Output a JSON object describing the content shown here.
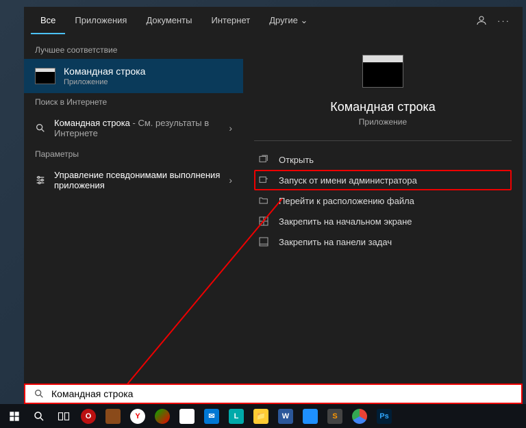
{
  "tabs": {
    "all": "Все",
    "apps": "Приложения",
    "docs": "Документы",
    "web": "Интернет",
    "more": "Другие"
  },
  "sections": {
    "best_match": "Лучшее соответствие",
    "web_search": "Поиск в Интернете",
    "settings": "Параметры"
  },
  "best_match": {
    "title": "Командная строка",
    "subtitle": "Приложение"
  },
  "web_result": {
    "prefix": "Командная строка",
    "suffix": " - См. результаты в Интернете"
  },
  "settings_result": {
    "title": "Управление псевдонимами выполнения приложения"
  },
  "preview": {
    "title": "Командная строка",
    "subtitle": "Приложение"
  },
  "actions": {
    "open": "Открыть",
    "run_admin": "Запуск от имени администратора",
    "open_location": "Перейти к расположению файла",
    "pin_start": "Закрепить на начальном экране",
    "pin_taskbar": "Закрепить на панели задач"
  },
  "search": {
    "value": "Командная строка"
  },
  "colors": {
    "highlight": "#e00",
    "accent": "#4cc2ff"
  }
}
